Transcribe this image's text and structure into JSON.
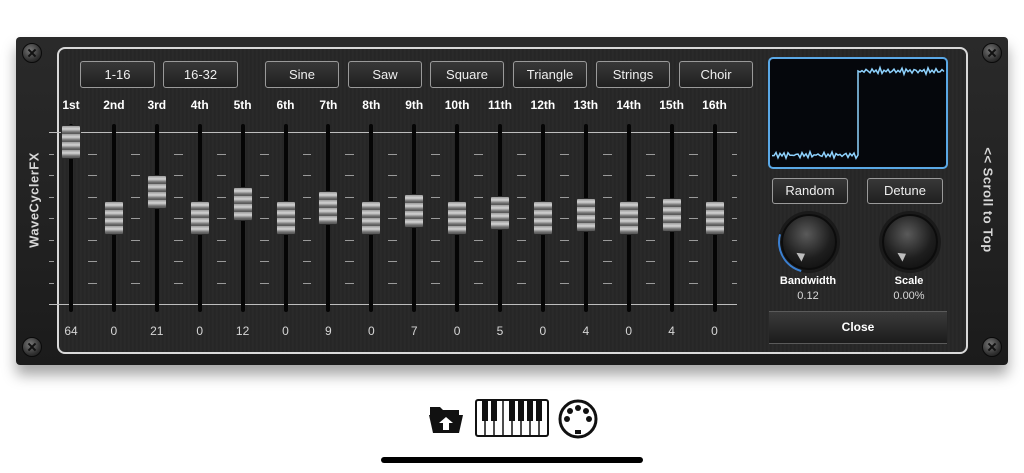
{
  "app": {
    "brand": "WaveCyclerFX",
    "scroll_to_top": "<< Scroll to Top"
  },
  "presets": [
    "1-16",
    "16-32",
    "Sine",
    "Saw",
    "Square",
    "Triangle",
    "Strings",
    "Choir"
  ],
  "harmonics": [
    {
      "label": "1st",
      "value": "64",
      "level": 0.94
    },
    {
      "label": "2nd",
      "value": "0",
      "level": 0.5
    },
    {
      "label": "3rd",
      "value": "21",
      "level": 0.65
    },
    {
      "label": "4th",
      "value": "0",
      "level": 0.5
    },
    {
      "label": "5th",
      "value": "12",
      "level": 0.58
    },
    {
      "label": "6th",
      "value": "0",
      "level": 0.5
    },
    {
      "label": "7th",
      "value": "9",
      "level": 0.56
    },
    {
      "label": "8th",
      "value": "0",
      "level": 0.5
    },
    {
      "label": "9th",
      "value": "7",
      "level": 0.54
    },
    {
      "label": "10th",
      "value": "0",
      "level": 0.5
    },
    {
      "label": "11th",
      "value": "5",
      "level": 0.53
    },
    {
      "label": "12th",
      "value": "0",
      "level": 0.5
    },
    {
      "label": "13th",
      "value": "4",
      "level": 0.52
    },
    {
      "label": "14th",
      "value": "0",
      "level": 0.5
    },
    {
      "label": "15th",
      "value": "4",
      "level": 0.52
    },
    {
      "label": "16th",
      "value": "0",
      "level": 0.5
    }
  ],
  "buttons": {
    "random": "Random",
    "detune": "Detune",
    "close": "Close"
  },
  "knobs": {
    "bandwidth": {
      "label": "Bandwidth",
      "value": "0.12"
    },
    "scale": {
      "label": "Scale",
      "value": "0.00%"
    }
  },
  "waveform": {
    "shape": "square",
    "line_color": "#8fd3ff",
    "border_color": "#5aa8e6"
  },
  "toolbar_icons": [
    "folder-icon",
    "piano-keyboard-icon",
    "midi-icon"
  ]
}
